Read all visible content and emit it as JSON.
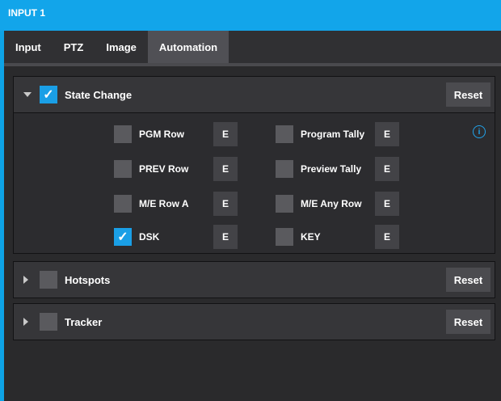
{
  "window": {
    "title": "INPUT 1"
  },
  "tabs": [
    {
      "label": "Input"
    },
    {
      "label": "PTZ"
    },
    {
      "label": "Image"
    },
    {
      "label": "Automation",
      "active": true
    }
  ],
  "state_change": {
    "title": "State Change",
    "expanded": true,
    "checked": true,
    "reset_label": "Reset",
    "info_glyph": "i",
    "options": [
      {
        "label": "PGM Row",
        "checked": false,
        "button": "E"
      },
      {
        "label": "Program Tally",
        "checked": false,
        "button": "E"
      },
      {
        "label": "PREV Row",
        "checked": false,
        "button": "E"
      },
      {
        "label": "Preview Tally",
        "checked": false,
        "button": "E"
      },
      {
        "label": "M/E Row A",
        "checked": false,
        "button": "E"
      },
      {
        "label": "M/E Any Row",
        "checked": false,
        "button": "E"
      },
      {
        "label": "DSK",
        "checked": true,
        "button": "E"
      },
      {
        "label": "KEY",
        "checked": false,
        "button": "E"
      }
    ]
  },
  "hotspots": {
    "title": "Hotspots",
    "expanded": false,
    "checked": false,
    "reset_label": "Reset"
  },
  "tracker": {
    "title": "Tracker",
    "expanded": false,
    "checked": false,
    "reset_label": "Reset"
  },
  "colors": {
    "accent": "#12a5ea",
    "checkbox_checked": "#1a9fe6",
    "background": "#2b2b2d"
  },
  "check_glyph": "✓"
}
